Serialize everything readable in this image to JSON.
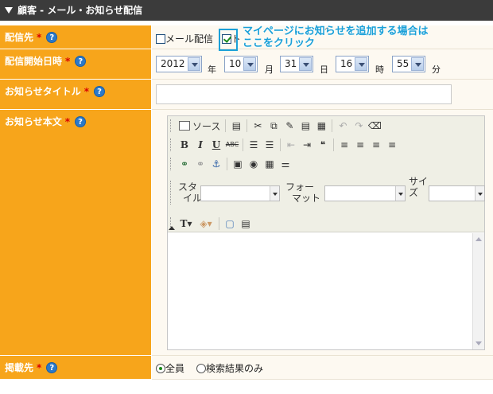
{
  "header": {
    "title": "顧客 - メール・お知らせ配信"
  },
  "form": {
    "delivery": {
      "label": "配信先",
      "required_mark": "*",
      "help": "?",
      "mail_label": "メール配信",
      "mypage_fragment": "ト",
      "mypage_suffix": "^"
    },
    "schedule": {
      "label": "配信開始日時",
      "required_mark": "*",
      "help": "?",
      "year": "2012",
      "year_unit": "年",
      "month": "10",
      "month_unit": "月",
      "day": "31",
      "day_unit": "日",
      "hour": "16",
      "hour_unit": "時",
      "minute": "55",
      "minute_unit": "分"
    },
    "notice_title": {
      "label": "お知らせタイトル",
      "required_mark": "*",
      "help": "?",
      "value": ""
    },
    "notice_body": {
      "label": "お知らせ本文",
      "required_mark": "*",
      "help": "?"
    },
    "target": {
      "label": "掲載先",
      "required_mark": "*",
      "help": "?",
      "options": [
        "全員",
        "検索結果のみ"
      ]
    }
  },
  "editor": {
    "source_label": "ソース",
    "style_label": [
      "スタ",
      "イル"
    ],
    "format_label": [
      "フォー",
      "マット"
    ],
    "size_label": [
      "サイ",
      "ズ"
    ],
    "text_color_glyph": "T",
    "bold": "B",
    "italic": "I",
    "underline": "U",
    "strike": "ABC"
  },
  "annotation": {
    "line1": "マイページにお知らせを追加する場合は",
    "line2": "ここをクリック"
  },
  "colors": {
    "label_bg": "#f7a51b",
    "header_bg": "#3b3b3b",
    "accent": "#1aa0d8"
  }
}
